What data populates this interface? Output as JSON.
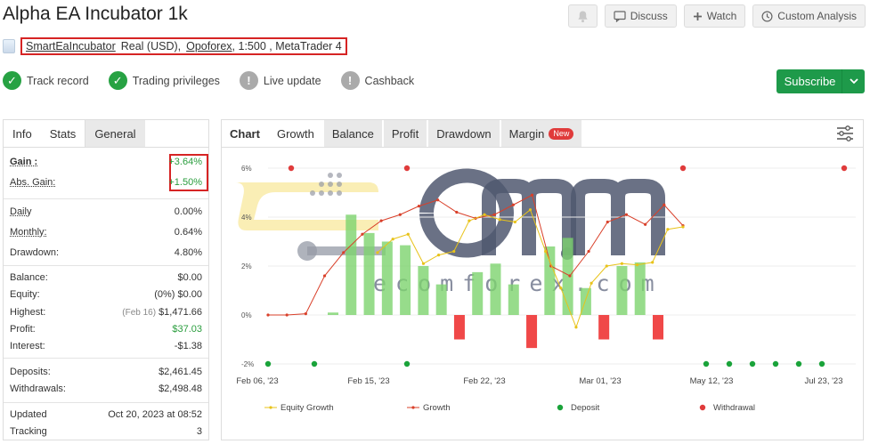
{
  "header": {
    "title": "Alpha EA Incubator 1k",
    "buttons": {
      "discuss": "Discuss",
      "watch": "Watch",
      "custom": "Custom Analysis"
    }
  },
  "account": {
    "owner": "SmartEaIncubator",
    "type": "Real (USD),",
    "broker": "Opoforex",
    "details": ", 1:500 , MetaTrader 4"
  },
  "badges": [
    {
      "label": "Track record",
      "status": "ok"
    },
    {
      "label": "Trading privileges",
      "status": "ok"
    },
    {
      "label": "Live update",
      "status": "na"
    },
    {
      "label": "Cashback",
      "status": "na"
    }
  ],
  "subscribe": {
    "label": "Subscribe"
  },
  "info_tabs": [
    "Info",
    "Stats",
    "General"
  ],
  "info": {
    "gain": {
      "label": "Gain :",
      "value": "+3.64%"
    },
    "abs_gain": {
      "label": "Abs. Gain:",
      "value": "+1.50%"
    },
    "daily": {
      "label": "Daily",
      "value": "0.00%"
    },
    "monthly": {
      "label": "Monthly:",
      "value": "0.64%"
    },
    "drawdown": {
      "label": "Drawdown:",
      "value": "4.80%"
    },
    "balance": {
      "label": "Balance:",
      "value": "$0.00"
    },
    "equity": {
      "label": "Equity:",
      "note": "(0%)",
      "value": "$0.00"
    },
    "highest": {
      "label": "Highest:",
      "note": "(Feb 16)",
      "value": "$1,471.66"
    },
    "profit": {
      "label": "Profit:",
      "value": "$37.03"
    },
    "interest": {
      "label": "Interest:",
      "value": "-$1.38"
    },
    "deposits": {
      "label": "Deposits:",
      "value": "$2,461.45"
    },
    "withdrawals": {
      "label": "Withdrawals:",
      "value": "$2,498.48"
    },
    "updated": {
      "label": "Updated",
      "value": "Oct 20, 2023 at 08:52"
    },
    "tracking": {
      "label": "Tracking",
      "value": "3"
    }
  },
  "chart_tabs": {
    "chart": "Chart",
    "growth": "Growth",
    "balance": "Balance",
    "profit": "Profit",
    "drawdown": "Drawdown",
    "margin": "Margin",
    "new": "New"
  },
  "watermark": "ecomforex.com",
  "colors": {
    "accent": "#1e9a4a",
    "equity": "#e8c31a",
    "growth": "#d9402a",
    "deposit": "#1aa33a",
    "withdrawal": "#e03b3b",
    "bar_pos": "#7dd36e",
    "bar_neg": "#ef3e3e"
  },
  "chart_data": {
    "type": "line",
    "y_ticks": [
      "6%",
      "4%",
      "2%",
      "0%",
      "-2%"
    ],
    "ylim": [
      -2,
      6
    ],
    "x_ticks": [
      "Feb 06, '23",
      "Feb 15, '23",
      "Feb 22, '23",
      "Mar 01, '23",
      "May 12, '23",
      "Jul 23, '23"
    ],
    "legend": [
      "Equity Growth",
      "Growth",
      "Deposit",
      "Withdrawal"
    ],
    "growth": [
      0.0,
      0.0,
      0.05,
      1.6,
      2.55,
      3.3,
      3.85,
      4.1,
      4.45,
      4.7,
      4.2,
      3.95,
      4.1,
      4.5,
      4.9,
      2.0,
      1.6,
      2.6,
      3.8,
      4.1,
      3.7,
      4.5,
      3.65
    ],
    "equity": [
      2.55,
      3.1,
      3.3,
      2.1,
      2.45,
      2.6,
      3.85,
      4.1,
      3.9,
      3.8,
      4.3,
      2.6,
      1.1,
      -0.5,
      1.3,
      2.0,
      2.1,
      2.05,
      2.15,
      3.5,
      3.6
    ],
    "bars": [
      0.1,
      4.1,
      3.35,
      3.0,
      2.85,
      2.0,
      1.25,
      -1.0,
      1.75,
      2.1,
      1.25,
      -1.35,
      2.8,
      3.15,
      1.1,
      -1.0,
      2.0,
      2.15,
      -1.0
    ],
    "deposits_markers": 7,
    "withdrawals_markers": 4
  }
}
